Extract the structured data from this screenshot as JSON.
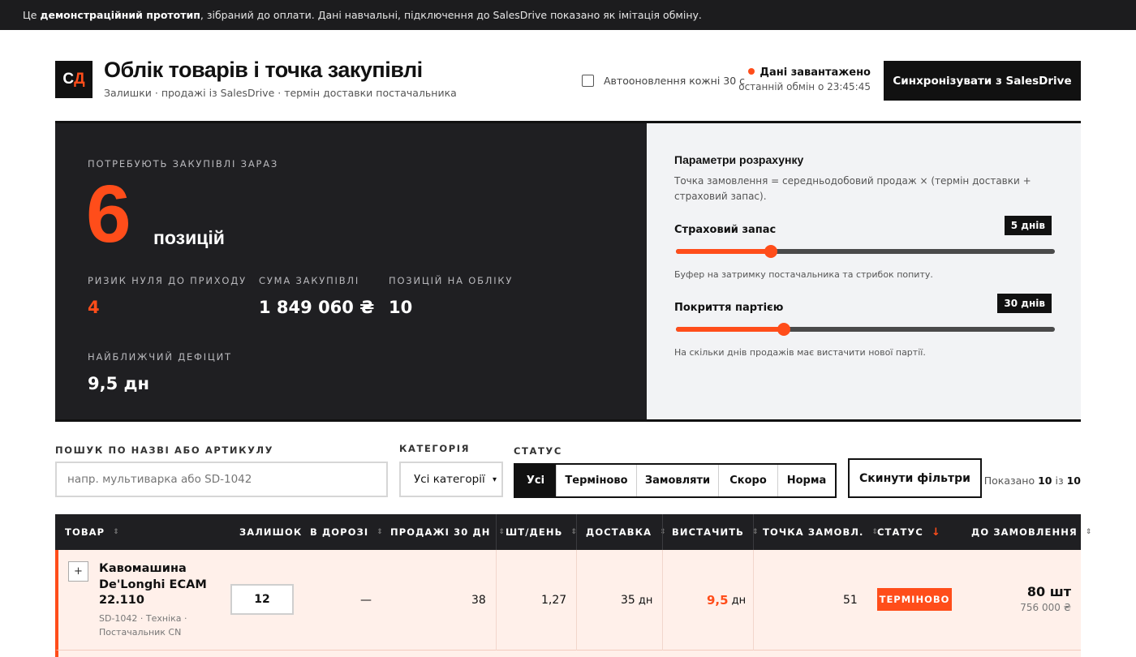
{
  "banner": {
    "prefix": "Це",
    "bold": "демонстраційний прототип",
    "suffix": ", зібраний до оплати. Дані навчальні, підключення до SalesDrive показано як імітація обміну."
  },
  "header": {
    "logo_a": "С",
    "logo_b": "Д",
    "title": "Облік товарів і точка закупівлі",
    "subtitle": "Залишки · продажі із SalesDrive · термін доставки постачальника",
    "autorefresh_label": "Автооновлення кожні 30 с",
    "status_title": "Дані завантажено",
    "status_time": "останній обмін о 23:45:45",
    "sync_button": "Синхронізувати з SalesDrive"
  },
  "summary": {
    "need_label": "ПОТРЕБУЮТЬ ЗАКУПІВЛІ ЗАРАЗ",
    "need_value": "6",
    "need_unit": "позицій",
    "risk_label": "РИЗИК НУЛЯ ДО ПРИХОДУ",
    "risk_value": "4",
    "sum_label": "СУМА ЗАКУПІВЛІ",
    "sum_value": "1 849 060 ₴",
    "count_label": "ПОЗИЦІЙ НА ОБЛІКУ",
    "count_value": "10",
    "deficit_label": "НАЙБЛИЖЧИЙ ДЕФІЦИТ",
    "deficit_value": "9,5 дн"
  },
  "params": {
    "title": "Параметри розрахунку",
    "formula": "Точка замовлення = середньодобовий продаж × (термін доставки + страховий запас).",
    "safety": {
      "label": "Страховий запас",
      "badge": "5 днів",
      "note": "Буфер на затримку постачальника та стрибок попиту.",
      "level": 0.25
    },
    "coverage": {
      "label": "Покриття партією",
      "badge": "30 днів",
      "note": "На скільки днів продажів має вистачити нової партії.",
      "level": 0.285
    }
  },
  "filters": {
    "search_label": "ПОШУК ПО НАЗВІ АБО АРТИКУЛУ",
    "search_placeholder": "напр. мультиварка або SD-1042",
    "category_label": "КАТЕГОРІЯ",
    "category_value": "Усі категорії",
    "status_label": "СТАТУС",
    "status_options": [
      "Усі",
      "Терміново",
      "Замовляти",
      "Скоро",
      "Норма"
    ],
    "reset_button": "Скинути фільтри",
    "shown_prefix": "Показано",
    "shown_count": "10",
    "shown_mid": "із",
    "shown_total": "10"
  },
  "table": {
    "headers": [
      "ТОВАР",
      "ЗАЛИШОК",
      "В ДОРОЗІ",
      "ПРОДАЖІ 30 ДН",
      "ШТ/ДЕНЬ",
      "ДОСТАВКА",
      "ВИСТАЧИТЬ",
      "ТОЧКА ЗАМОВЛ.",
      "СТАТУС",
      "ДО ЗАМОВЛЕННЯ"
    ],
    "sort_icon": "⇕",
    "sort_active_icon": "↓",
    "rows": [
      {
        "expand": "+",
        "name": "Кавомашина De'Longhi ECAM 22.110",
        "meta": "SD-1042 · Техніка · Постачальник CN",
        "stock": "12",
        "transit": "—",
        "sales30": "38",
        "perday": "1,27",
        "delivery": "35",
        "delivery_unit": "дн",
        "cover": "9,5",
        "cover_unit": "дн",
        "reorder": "51",
        "status": "ТЕРМІНОВО",
        "order_qty": "80 шт",
        "order_sum": "756 000 ₴"
      }
    ]
  },
  "colors": {
    "accent": "#ff4d1a",
    "dark": "#1f1f22",
    "row_urgent_bg": "#fff0ea"
  }
}
